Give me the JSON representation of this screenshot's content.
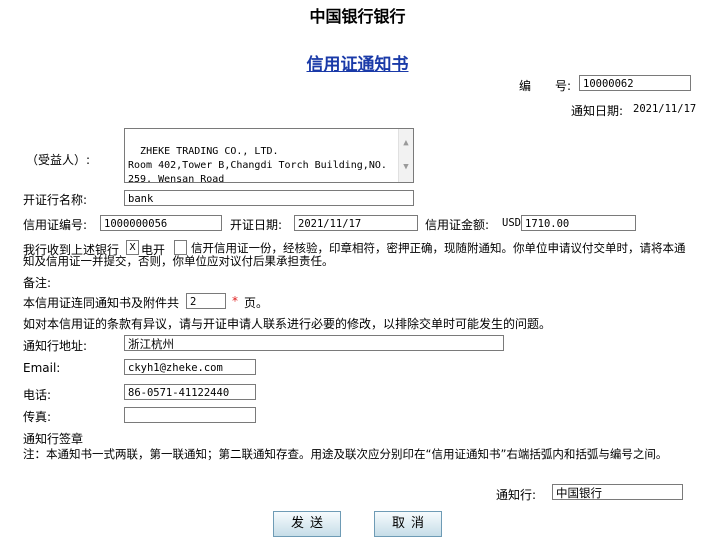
{
  "header": {
    "bank_name": "中国银行银行",
    "doc_title": "信用证通知书",
    "number_label": "编　　号:",
    "number_value": "10000062",
    "notify_date_label": "通知日期:",
    "notify_date_value": "2021/11/17"
  },
  "beneficiary": {
    "label": "（受益人）:",
    "address": "ZHEKE TRADING CO., LTD.\nRoom 402,Tower B,Changdi Torch Building,NO.\n259, Wensan Road"
  },
  "issuing_bank": {
    "label": "开证行名称:",
    "value": "bank"
  },
  "lc": {
    "number_label": "信用证编号:",
    "number_value": "1000000056",
    "issue_date_label": "开证日期:",
    "issue_date_value": "2021/11/17",
    "amount_label": "信用证金额:",
    "currency": "USD",
    "amount_value": "1710.00"
  },
  "notice": {
    "text_before": "我行收到上述银行",
    "check1_mark": "X",
    "check1_label": "电开",
    "check2_mark": "",
    "text_after": "信开信用证一份，经核验，印章相符，密押正确，现随附通知。你单位申请议付交单时，请将本通知及信用证一并提交，否则，你单位应对议付后果承担责任。"
  },
  "remarks_label": "备注:",
  "attachment": {
    "text_before": "本信用证连同通知书及附件共",
    "pages_value": "2",
    "required_mark": "*",
    "text_after": "页。"
  },
  "objection_text": "如对本信用证的条款有异议，请与开证申请人联系进行必要的修改，以排除交单时可能发生的问题。",
  "contact": {
    "address_label": "通知行地址:",
    "address_value": "浙江杭州",
    "email_label": "Email:",
    "email_value": "ckyh1@zheke.com",
    "phone_label": "电话:",
    "phone_value": "86-0571-41122440",
    "fax_label": "传真:",
    "fax_value": ""
  },
  "signature_label": "通知行签章",
  "note_text": "注：本通知书一式两联，第一联通知；第二联通知存查。用途及联次应分别印在“信用证通知书”右端括弧内和括弧与编号之间。",
  "advising_bank": {
    "label": "通知行:",
    "value": "中国银行"
  },
  "buttons": {
    "send": "发送",
    "cancel": "取消"
  }
}
